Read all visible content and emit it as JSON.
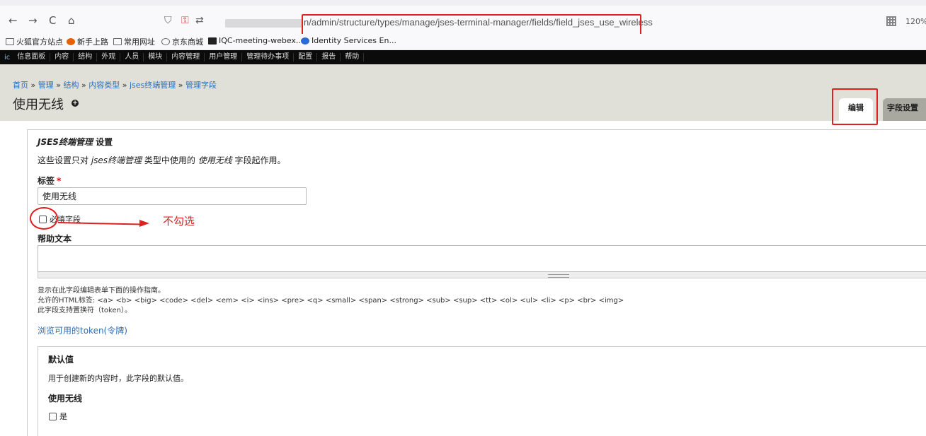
{
  "browser": {
    "back": "←",
    "forward": "→",
    "reload": "C",
    "home": "⌂",
    "url": "n/admin/structure/types/manage/jses-terminal-manager/fields/field_jses_use_wireless",
    "zoom": "120%"
  },
  "bookmarks": [
    "火狐官方站点",
    "新手上路",
    "常用网址",
    "京东商城",
    "IQC-meeting-webex...",
    "Identity Services En..."
  ],
  "toolbar": {
    "logo": "ic",
    "items": [
      "信息面板",
      "内容",
      "结构",
      "外观",
      "人员",
      "模块",
      "内容管理",
      "用户管理",
      "管理待办事项",
      "配置",
      "报告",
      "帮助"
    ]
  },
  "header": {
    "breadcrumb": [
      "首页",
      "管理",
      "结构",
      "内容类型",
      "jses终端管理",
      "管理字段"
    ],
    "breadcrumb_sep": "»",
    "title": "使用无线",
    "tabs": [
      "编辑",
      "字段设置"
    ]
  },
  "form": {
    "section_title_em": "JSES终端管理",
    "section_title_rest": " 设置",
    "description_parts": [
      "这些设置只对 ",
      "jses终端管理",
      " 类型中使用的 ",
      "使用无线",
      " 字段起作用。"
    ],
    "label_title": "标签",
    "required_mark": "*",
    "label_value": "使用无线",
    "required_checkbox": "必填字段",
    "annotation": "不勾选",
    "help_label": "帮助文本",
    "help_desc_1": "显示在此字段编辑表单下面的操作指南。",
    "help_desc_2": "允许的HTML标签: <a> <b> <big> <code> <del> <em> <i> <ins> <pre> <q> <small> <span> <strong> <sub> <sup> <tt> <ol> <ul> <li> <p> <br> <img>",
    "help_desc_3": "此字段支持置换符（token）。",
    "token_link": "浏览可用的token(令牌)"
  },
  "default": {
    "title": "默认值",
    "description": "用于创建新的内容时，此字段的默认值。",
    "field_label": "使用无线",
    "checkbox_label": "是"
  },
  "colors": {
    "link": "#2a6ebb",
    "annotation_red": "#e02020",
    "toolbar_bg": "#0b0b0b",
    "header_bg": "#e0e0d8"
  }
}
